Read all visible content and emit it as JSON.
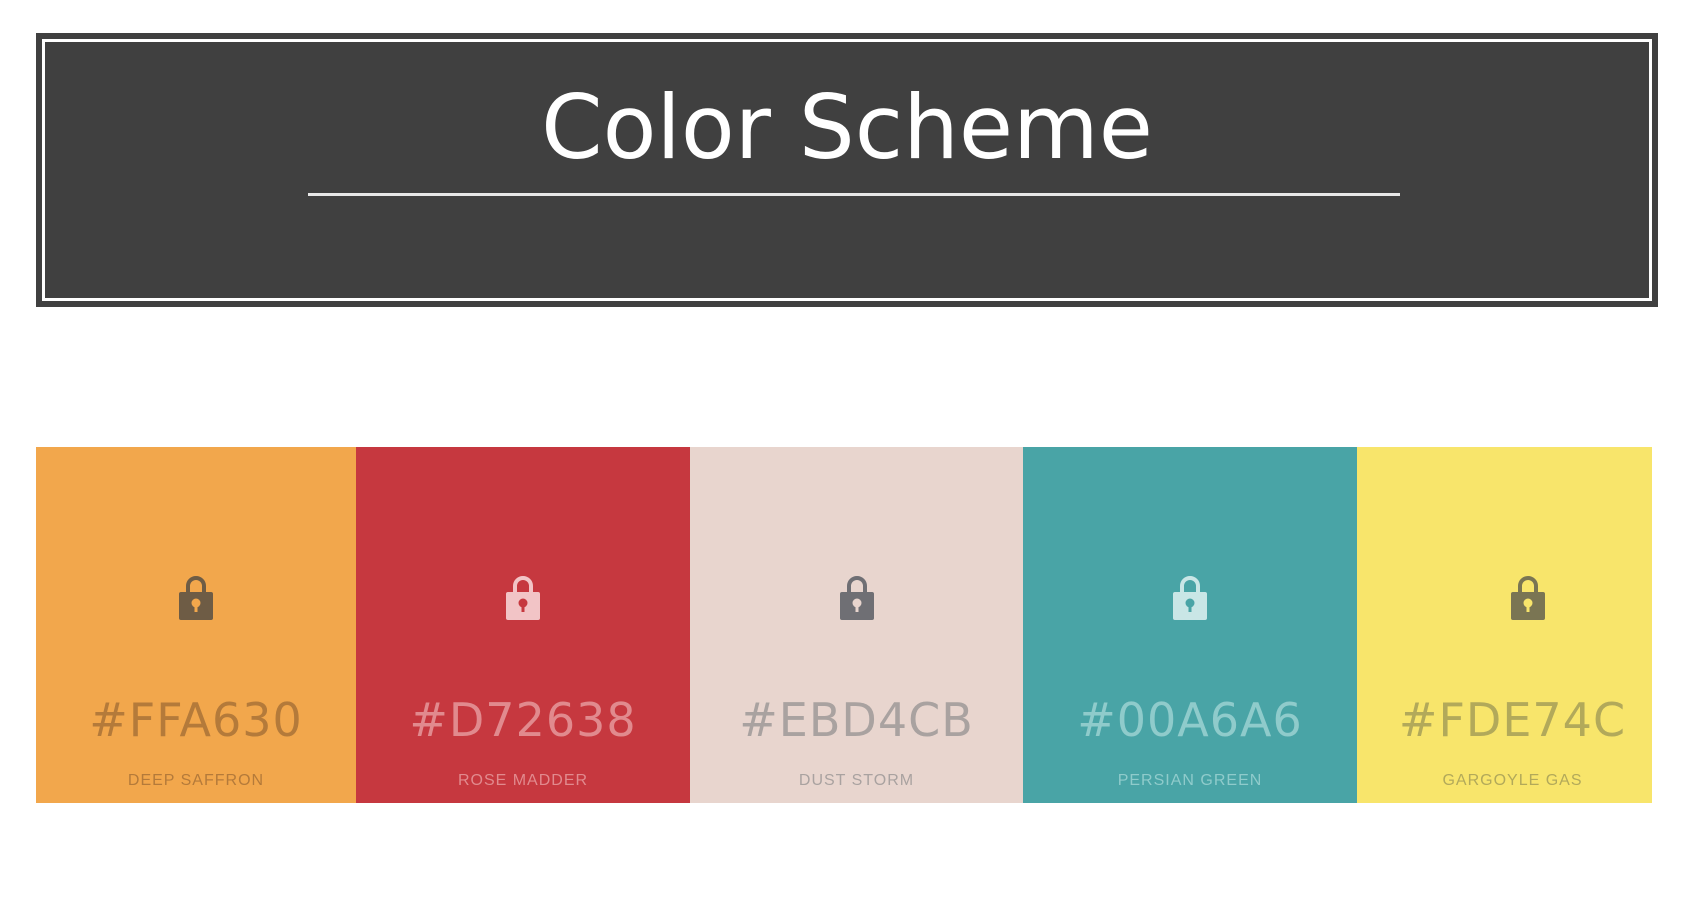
{
  "header": {
    "title": "Color Scheme"
  },
  "palette": {
    "swatches": [
      {
        "hex_label": "#FFA630",
        "name": "DEEP SAFFRON",
        "color": "#F2A74C",
        "text_color": "#B47A3A",
        "lock_color": "#6E5C45",
        "keyhole_color": "#F2A74C"
      },
      {
        "hex_label": "#D72638",
        "name": "ROSE MADDER",
        "color": "#C6383F",
        "text_color": "#E18A8E",
        "lock_color": "#F2C4C6",
        "keyhole_color": "#C6383F"
      },
      {
        "hex_label": "#EBD4CB",
        "name": "DUST STORM",
        "color": "#E8D5CE",
        "text_color": "#A9A2A0",
        "lock_color": "#6F6F74",
        "keyhole_color": "#E8D5CE"
      },
      {
        "hex_label": "#00A6A6",
        "name": "PERSIAN GREEN",
        "color": "#49A4A6",
        "text_color": "#8FCBCB",
        "lock_color": "#C9E6E6",
        "keyhole_color": "#49A4A6"
      },
      {
        "hex_label": "#FDE74C",
        "name": "GARGOYLE GAS",
        "color": "#F8E56B",
        "text_color": "#B2A95A",
        "lock_color": "#7A7553",
        "keyhole_color": "#F8E56B"
      }
    ]
  }
}
